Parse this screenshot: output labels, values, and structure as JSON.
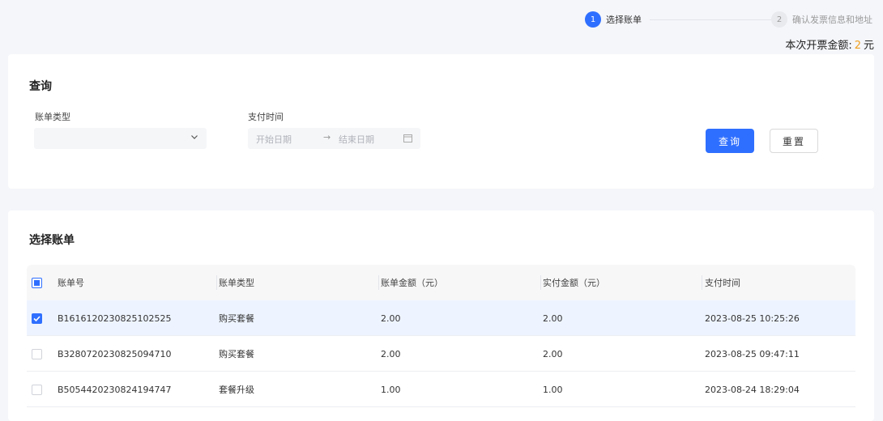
{
  "steps": [
    {
      "number": "1",
      "label": "选择账单",
      "active": true
    },
    {
      "number": "2",
      "label": "确认发票信息和地址",
      "active": false
    }
  ],
  "amount": {
    "label": "本次开票金额:",
    "value": "2",
    "unit": "元",
    "color": "#f0a020"
  },
  "query": {
    "title": "查询",
    "bill_type_label": "账单类型",
    "bill_type_value": "",
    "pay_time_label": "支付时间",
    "start_placeholder": "开始日期",
    "end_placeholder": "结束日期",
    "search_button": "查询",
    "reset_button": "重置"
  },
  "list": {
    "title": "选择账单",
    "columns": [
      "账单号",
      "账单类型",
      "账单金额（元）",
      "实付金额（元）",
      "支付时间"
    ],
    "rows": [
      {
        "checked": true,
        "cells": [
          "B1616120230825102525",
          "购买套餐",
          "2.00",
          "2.00",
          "2023-08-25 10:25:26"
        ]
      },
      {
        "checked": false,
        "cells": [
          "B3280720230825094710",
          "购买套餐",
          "2.00",
          "2.00",
          "2023-08-25 09:47:11"
        ]
      },
      {
        "checked": false,
        "cells": [
          "B5054420230824194747",
          "套餐升级",
          "1.00",
          "1.00",
          "2023-08-24 18:29:04"
        ]
      }
    ]
  },
  "colors": {
    "accent": "#2f6fff",
    "selected_row": "#eef4ff"
  }
}
